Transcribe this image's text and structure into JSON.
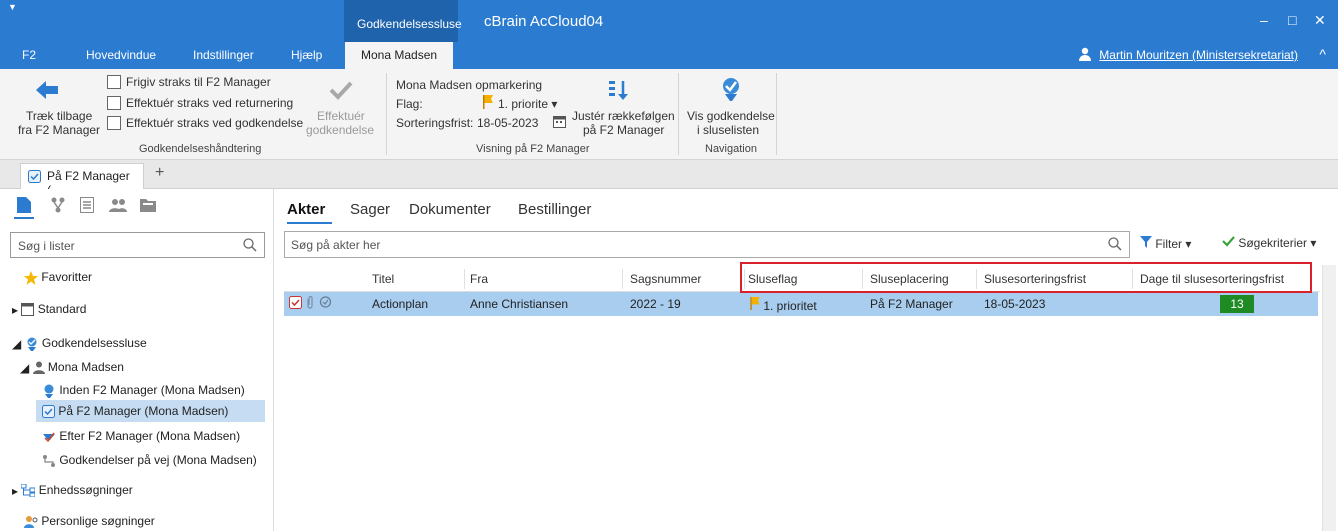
{
  "titlebar": {
    "context_tab": "Godkendelsessluse",
    "app_title": "cBrain AcCloud04",
    "minimize": "–",
    "maximize": "□",
    "close": "✕"
  },
  "menubar": {
    "items": [
      "F2",
      "Hovedvindue",
      "Indstillinger",
      "Hjælp",
      "Mona Madsen"
    ],
    "user": "Martin Mouritzen (Ministersekretariat)"
  },
  "ribbon": {
    "pull_back_line1": "Træk tilbage",
    "pull_back_line2": "fra F2 Manager",
    "checkbox1": "Frigiv straks til F2 Manager",
    "checkbox2": "Effektuér straks ved returnering",
    "checkbox3": "Effektuér straks ved godkendelse",
    "effectuate_line1": "Effektuér",
    "effectuate_line2": "godkendelse",
    "group1_label": "Godkendelseshåndtering",
    "markup_label": "Mona Madsen opmarkering",
    "flag_label": "Flag:",
    "flag_value": "1. priorite",
    "sort_label": "Sorteringsfrist:",
    "sort_value": "18-05-2023",
    "adjust_line1": "Justér rækkefølgen",
    "adjust_line2": "på F2 Manager",
    "group2_label": "Visning på F2 Manager",
    "show_line1": "Vis godkendelse",
    "show_line2": "i sluselisten",
    "group3_label": "Navigation"
  },
  "tabstrip": {
    "doc_tab": "På F2 Manager (...",
    "add": "+"
  },
  "left": {
    "search_placeholder": "Søg i lister",
    "tree": {
      "favorites": "Favoritter",
      "standard": "Standard",
      "sluse": "Godkendelsessluse",
      "mona": "Mona Madsen",
      "inden": "Inden F2 Manager (Mona Madsen)",
      "paa": "På F2 Manager (Mona Madsen)",
      "efter": "Efter F2 Manager (Mona Madsen)",
      "paavej": "Godkendelser på vej (Mona Madsen)",
      "enheds": "Enhedssøgninger",
      "personlige": "Personlige søgninger"
    }
  },
  "main": {
    "tabs": [
      "Akter",
      "Sager",
      "Dokumenter",
      "Bestillinger"
    ],
    "search_placeholder": "Søg på akter her",
    "filter": "Filter",
    "criteria": "Søgekriterier",
    "columns": [
      "Titel",
      "Fra",
      "Sagsnummer",
      "Sluseflag",
      "Sluseplacering",
      "Slusesorteringsfrist",
      "Dage til slusesorteringsfrist"
    ],
    "rows": [
      {
        "titel": "Actionplan",
        "fra": "Anne Christiansen",
        "sagsnummer": "2022 - 19",
        "sluseflag": "1. prioritet",
        "sluseplacering": "På F2 Manager",
        "frist": "18-05-2023",
        "dage": "13"
      }
    ]
  }
}
